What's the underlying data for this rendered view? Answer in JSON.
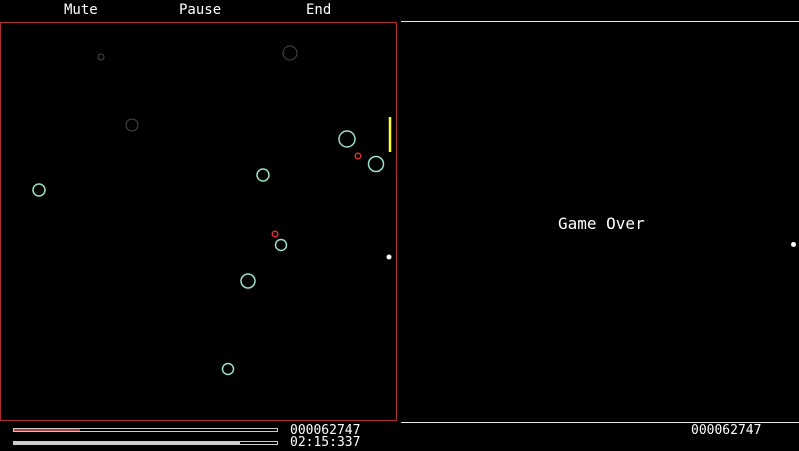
{
  "menu": {
    "mute": "Mute",
    "pause": "Pause",
    "end": "End"
  },
  "right_panel": {
    "message": "Game Over",
    "score": "000062747"
  },
  "hud": {
    "score": "000062747",
    "time": "02:15:337",
    "health_fraction": 0.25,
    "health_color": "#b03a3a",
    "energy_fraction": 0.86,
    "energy_color": "#cfcfcf"
  },
  "colors": {
    "asteroid": "#9de0c4",
    "faded_asteroid": "#4a4a4a",
    "enemy": "#d83030",
    "player": "#ffff33",
    "border": "#b03030"
  }
}
